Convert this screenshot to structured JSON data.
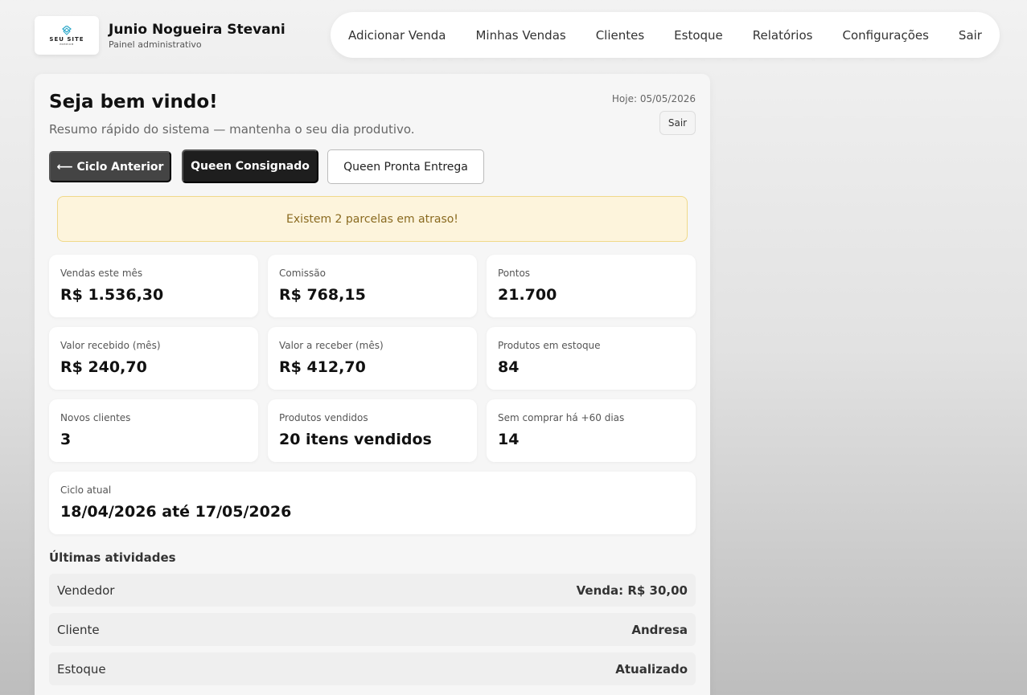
{
  "brand": {
    "logo_text": "SEU SITE",
    "logo_sub": "PREMIUM",
    "name": "Junio Nogueira Stevani",
    "subtitle": "Painel administrativo"
  },
  "nav": {
    "items": [
      "Adicionar Venda",
      "Minhas Vendas",
      "Clientes",
      "Estoque",
      "Relatórios",
      "Configurações",
      "Sair"
    ]
  },
  "panel": {
    "title": "Seja bem vindo!",
    "subtitle": "Resumo rápido do sistema — mantenha o seu dia produtivo.",
    "today": "Hoje: 05/05/2026",
    "sair": "Sair"
  },
  "buttons": {
    "prev": "⟵ Ciclo Anterior",
    "consignado": "Queen Consignado",
    "pronta": "Queen Pronta Entrega"
  },
  "alert": "Existem 2 parcelas em atraso!",
  "stats": [
    {
      "label": "Vendas este mês",
      "value": "R$ 1.536,30"
    },
    {
      "label": "Comissão",
      "value": "R$ 768,15"
    },
    {
      "label": "Pontos",
      "value": "21.700"
    },
    {
      "label": "Valor recebido (mês)",
      "value": "R$ 240,70"
    },
    {
      "label": "Valor a receber (mês)",
      "value": "R$ 412,70"
    },
    {
      "label": "Produtos em estoque",
      "value": "84"
    },
    {
      "label": "Novos clientes",
      "value": "3"
    },
    {
      "label": "Produtos vendidos",
      "value": "20 itens vendidos"
    },
    {
      "label": "Sem comprar há +60 dias",
      "value": "14"
    }
  ],
  "cycle": {
    "label": "Ciclo atual",
    "value": "18/04/2026 até 17/05/2026"
  },
  "activities": {
    "title": "Últimas atividades",
    "items": [
      {
        "left": "Vendedor",
        "right": "Venda: R$ 30,00"
      },
      {
        "left": "Cliente",
        "right": "Andresa"
      },
      {
        "left": "Estoque",
        "right": "Atualizado"
      }
    ]
  },
  "colors": {
    "accent_dark": "#1e1e1e",
    "alert_bg": "#fdf4dc",
    "alert_text": "#8a6a20"
  }
}
